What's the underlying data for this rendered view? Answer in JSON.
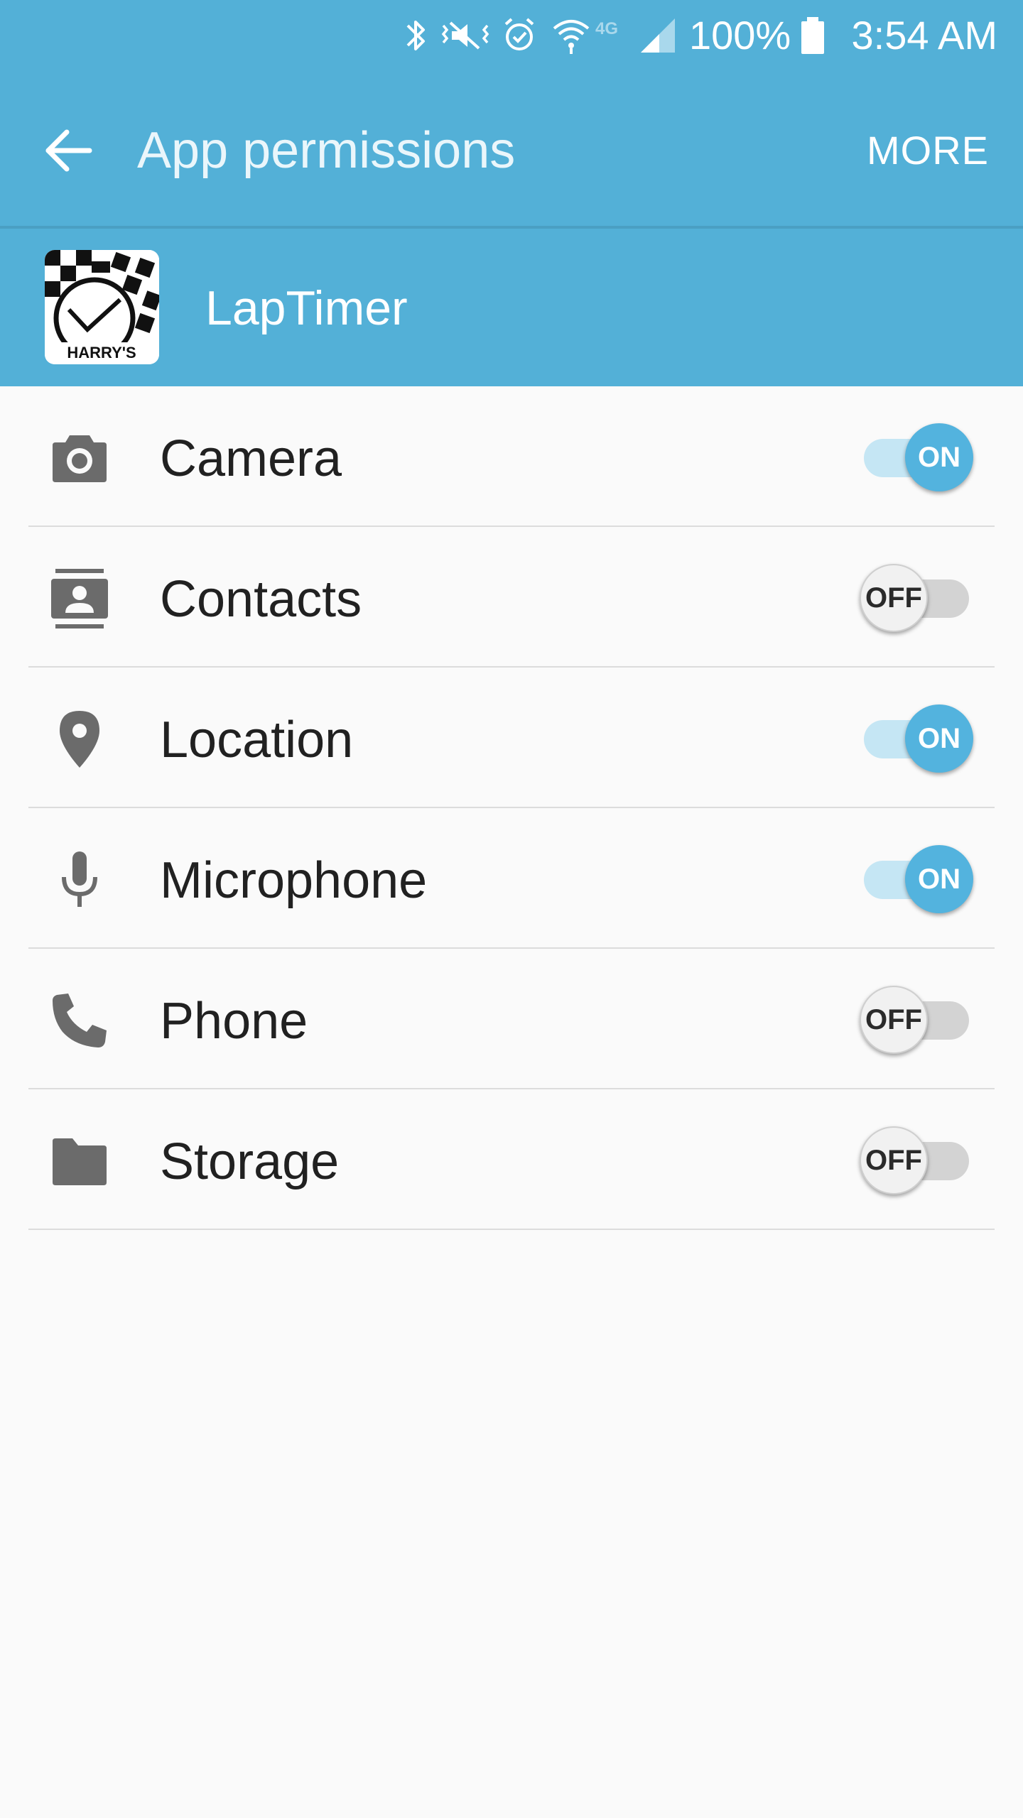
{
  "status_bar": {
    "battery_percent": "100%",
    "time": "3:54 AM",
    "network": "4G",
    "icons": [
      "bluetooth-icon",
      "vibrate-icon",
      "alarm-icon",
      "wifi-icon",
      "lte-icon",
      "signal-icon",
      "battery-icon"
    ]
  },
  "action_bar": {
    "back_icon": "arrow-left-icon",
    "title": "App permissions",
    "more_label": "MORE"
  },
  "app": {
    "name": "LapTimer",
    "icon_text": "HARRY'S"
  },
  "permissions": [
    {
      "label": "Camera",
      "icon": "camera-icon",
      "state": "ON",
      "enabled": true
    },
    {
      "label": "Contacts",
      "icon": "contacts-icon",
      "state": "OFF",
      "enabled": false
    },
    {
      "label": "Location",
      "icon": "location-pin-icon",
      "state": "ON",
      "enabled": true
    },
    {
      "label": "Microphone",
      "icon": "microphone-icon",
      "state": "ON",
      "enabled": true
    },
    {
      "label": "Phone",
      "icon": "phone-icon",
      "state": "OFF",
      "enabled": false
    },
    {
      "label": "Storage",
      "icon": "folder-icon",
      "state": "OFF",
      "enabled": false
    }
  ],
  "colors": {
    "primary": "#53b0d7",
    "toggle_on_thumb": "#53b3de",
    "toggle_on_track": "#c5e6f4",
    "toggle_off_thumb": "#f1f1f1",
    "toggle_off_track": "#d3d3d3",
    "text_primary": "#212121",
    "icon_gray": "#6b6b6b",
    "background": "#fafafa"
  }
}
